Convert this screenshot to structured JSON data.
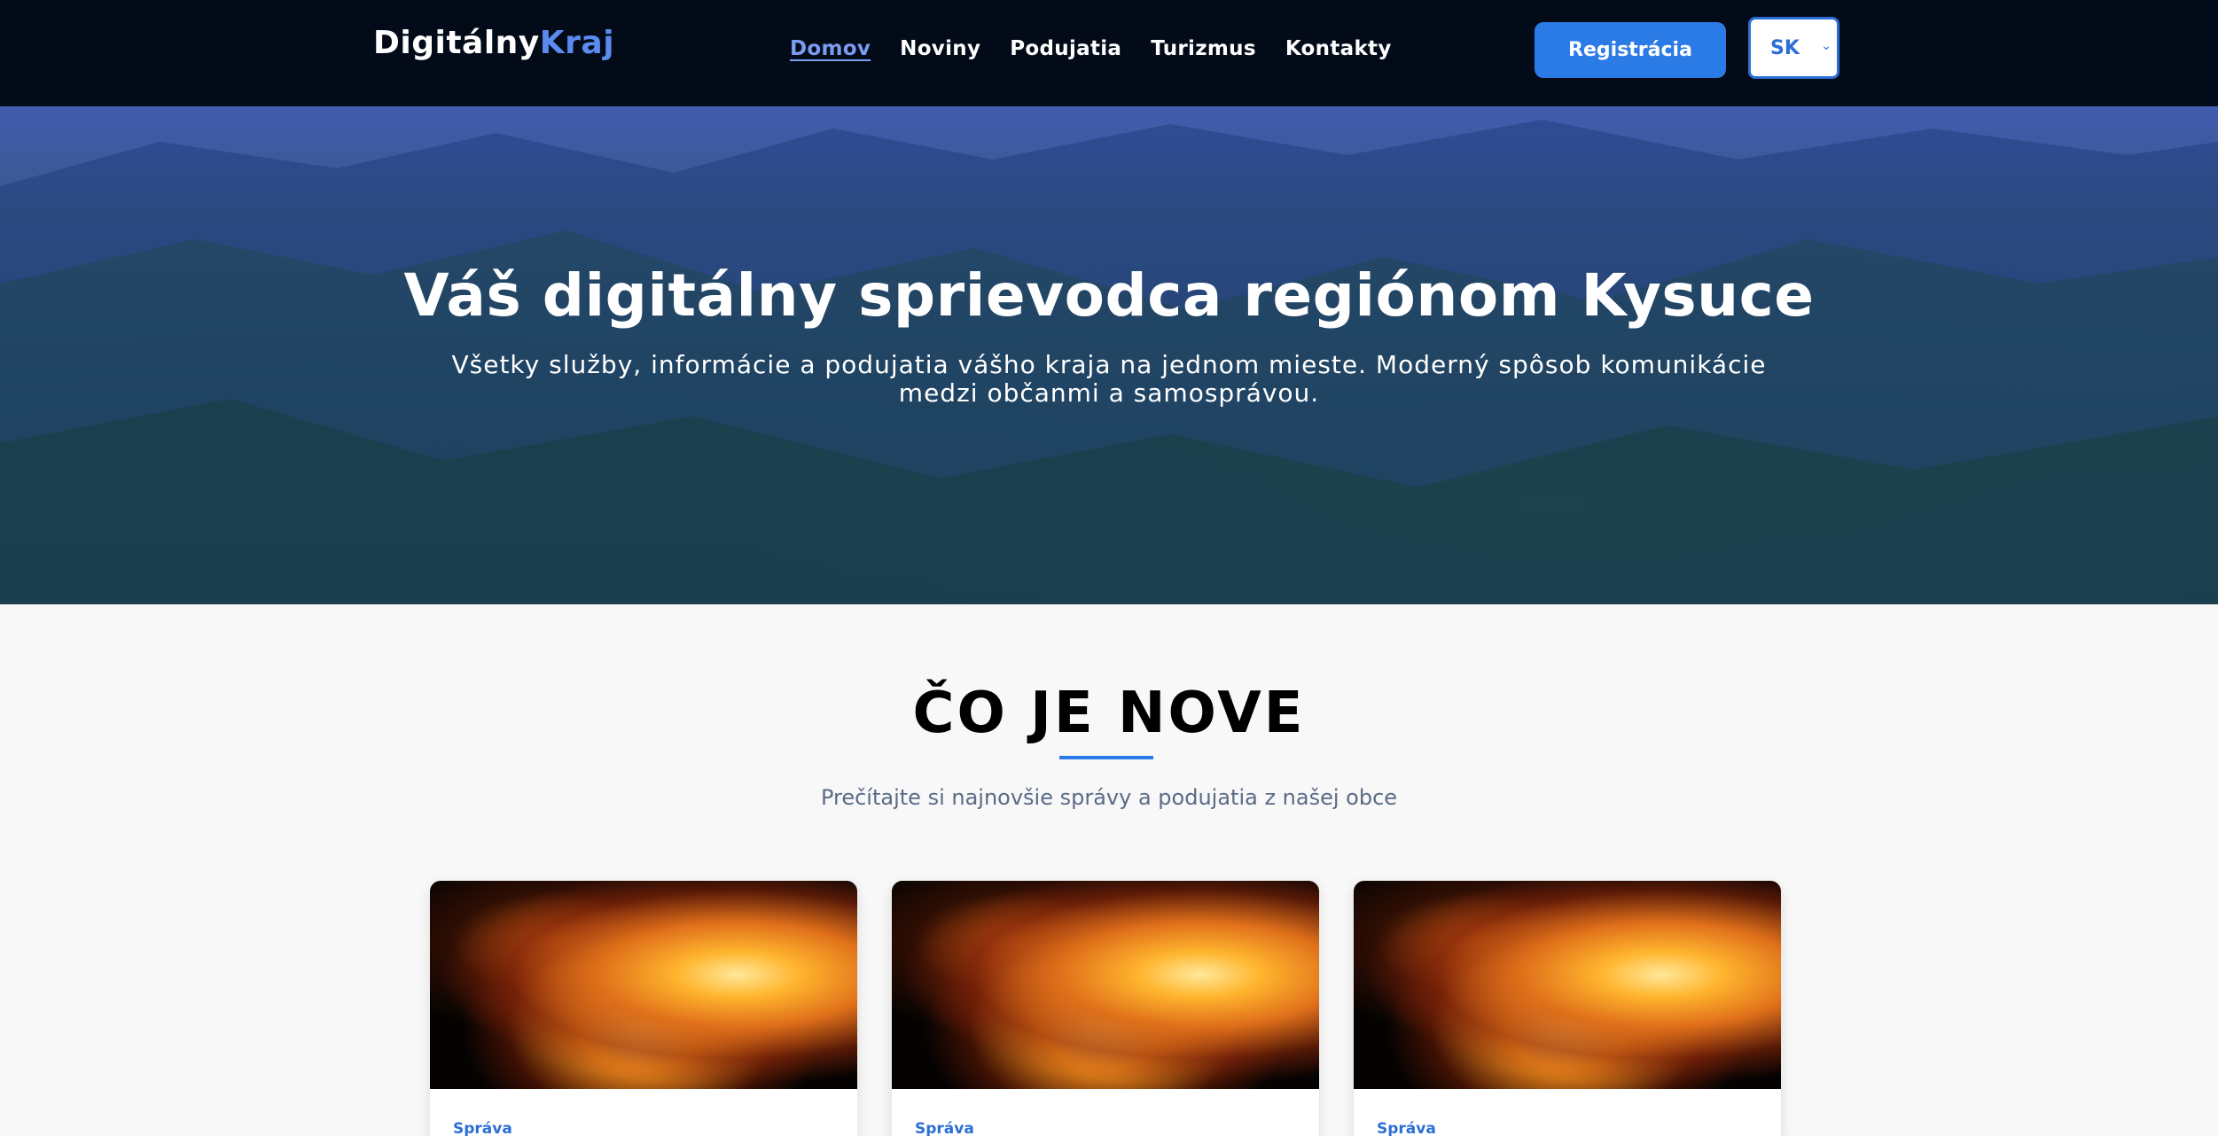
{
  "header": {
    "logo_main": "Digitálny",
    "logo_accent": "Kraj",
    "nav": [
      "Domov",
      "Noviny",
      "Podujatia",
      "Turizmus",
      "Kontakty"
    ],
    "active_nav": "Domov",
    "register_label": "Registrácia",
    "language": "SK"
  },
  "hero": {
    "title": "Váš digitálny sprievodca regiónom Kysuce",
    "subtitle": "Všetky služby, informácie a podujatia vášho kraja na jednom mieste. Moderný spôsob komunikácie medzi občanmi a samosprávou."
  },
  "news": {
    "title": "ČO JE NOVE",
    "subtitle": "Prečítajte si najnovšie správy a podujatia z našej obce",
    "cards": [
      {
        "category": "Správa"
      },
      {
        "category": "Správa"
      },
      {
        "category": "Správa"
      }
    ]
  },
  "colors": {
    "header_bg": "#030b18",
    "accent": "#2b7be6",
    "logo_accent": "#5b8bef",
    "hero_overlay": "#2846b4"
  }
}
